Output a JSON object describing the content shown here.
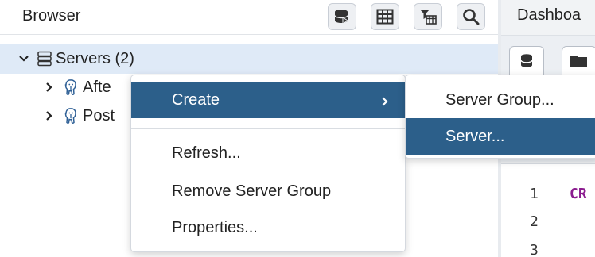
{
  "browser": {
    "title": "Browser",
    "toolbar_icons": [
      "database-query-icon",
      "table-grid-icon",
      "filter-table-icon",
      "search-icon"
    ]
  },
  "tree": {
    "servers": {
      "label": "Servers (2)",
      "expanded": true
    },
    "children": [
      {
        "label": "Afte"
      },
      {
        "label": "Post"
      }
    ]
  },
  "right_panel": {
    "tab_label": "Dashboa",
    "editor_lines": [
      "1",
      "2",
      "3"
    ],
    "keyword": "CR"
  },
  "context_menu": {
    "items": [
      {
        "label": "Create",
        "has_submenu": true
      },
      {
        "label": "Refresh..."
      },
      {
        "label": "Remove Server Group"
      },
      {
        "label": "Properties..."
      }
    ],
    "submenu": [
      {
        "label": "Server Group..."
      },
      {
        "label": "Server..."
      }
    ]
  },
  "colors": {
    "highlight": "#2c5f8a",
    "selected_row": "#dfeaf7",
    "keyword": "#8b1c8f"
  }
}
